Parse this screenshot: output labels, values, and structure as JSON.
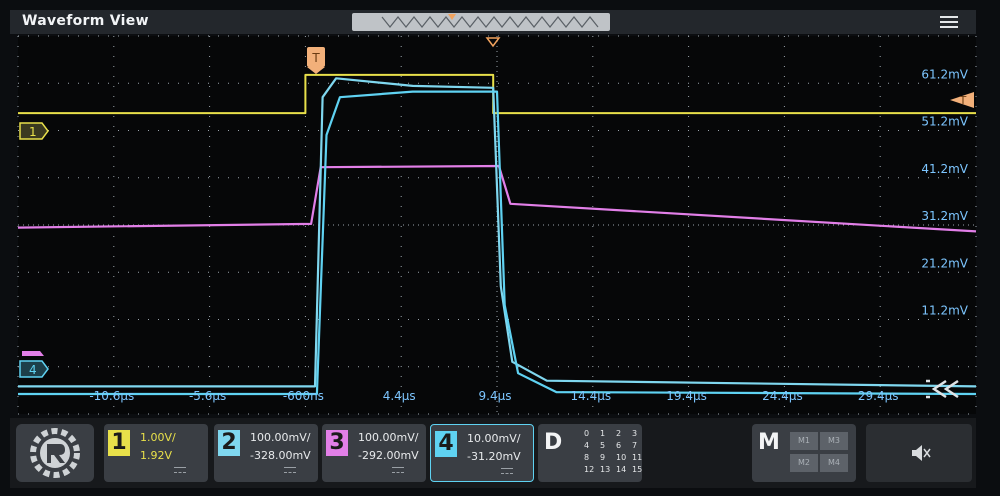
{
  "app": {
    "title": "Waveform View"
  },
  "icons": {
    "menu": "hamburger-menu-icon",
    "trigger_position": "trigger-marker-icon",
    "trigger_level": "trigger-level-marker-icon",
    "collapse": "collapse-arrows-icon",
    "logo": "brand-logo-icon",
    "speaker": "speaker-muted-icon"
  },
  "colors": {
    "ch1": "#e8e04a",
    "ch2": "#7fd7ef",
    "ch3": "#e27fe8",
    "ch4": "#5fd2f2",
    "trigger": "#f2a35e",
    "axis_label": "#7dc6ff"
  },
  "trigger": {
    "label": "T"
  },
  "markers": {
    "ch1": "1",
    "ch4": "4"
  },
  "chart_data": {
    "type": "line",
    "x_unit": "µs",
    "y_unit": "mV",
    "xlim": [
      -15.6,
      34.4
    ],
    "ylim": [
      -28.8,
      71.2
    ],
    "grid": true,
    "x_ticks": [
      "-10.6µs",
      "-5.6µs",
      "-600ns",
      "4.4µs",
      "9.4µs",
      "14.4µs",
      "19.4µs",
      "24.4µs",
      "29.4µs"
    ],
    "y_ticks": [
      "61.2mV",
      "51.2mV",
      "41.2mV",
      "31.2mV",
      "21.2mV",
      "11.2mV"
    ],
    "series": [
      {
        "channel": "1",
        "x": [
          -15.6,
          -0.6,
          -0.6,
          9.2,
          9.2,
          34.4
        ],
        "y": [
          50.8,
          50.8,
          60.9,
          60.9,
          50.8,
          50.8
        ]
      },
      {
        "channel": "3",
        "x": [
          -15.6,
          -0.3,
          0.2,
          9.5,
          10.1,
          34.4
        ],
        "y": [
          20.5,
          21.5,
          36.5,
          36.8,
          26.8,
          19.5
        ]
      },
      {
        "channel": "2",
        "x": [
          -15.6,
          -0.1,
          0.3,
          1.0,
          5.0,
          9.2,
          9.6,
          10.2,
          12.0,
          34.4
        ],
        "y": [
          -21.5,
          -21.5,
          55,
          60,
          58,
          57.5,
          5,
          -15,
          -20,
          -21.5
        ]
      },
      {
        "channel": "4",
        "x": [
          -15.6,
          0.0,
          0.5,
          1.2,
          5.0,
          9.4,
          9.8,
          10.5,
          12.5,
          34.4
        ],
        "y": [
          -23.5,
          -23.5,
          45,
          55,
          56.5,
          56.5,
          0,
          -18,
          -23,
          -23.5
        ]
      }
    ]
  },
  "channels": [
    {
      "id": "1",
      "scale": "1.00V/",
      "offset": "1.92V"
    },
    {
      "id": "2",
      "scale": "100.00mV/",
      "offset": "-328.00mV"
    },
    {
      "id": "3",
      "scale": "100.00mV/",
      "offset": "-292.00mV"
    },
    {
      "id": "4",
      "scale": "10.00mV/",
      "offset": "-31.20mV"
    }
  ],
  "digital": {
    "label": "D",
    "channels": [
      "0",
      "1",
      "2",
      "3",
      "4",
      "5",
      "6",
      "7",
      "8",
      "9",
      "10",
      "11",
      "12",
      "13",
      "14",
      "15"
    ]
  },
  "math": {
    "label": "M",
    "items": [
      "M1",
      "M3",
      "M2",
      "M4"
    ]
  }
}
